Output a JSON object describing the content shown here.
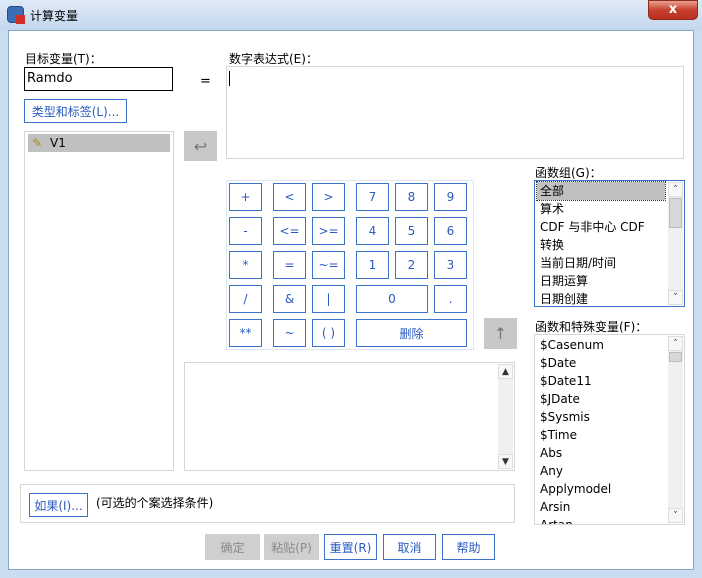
{
  "window": {
    "title": "计算变量",
    "close": "x"
  },
  "target": {
    "label": "目标变量(T)：",
    "value": "Ramdo"
  },
  "equals": "=",
  "expression": {
    "label": "数字表达式(E)：",
    "value": ""
  },
  "type_label_button": "类型和标签(L)...",
  "variables": [
    "V1"
  ],
  "keypad": [
    [
      "+",
      "<",
      ">",
      "7",
      "8",
      "9"
    ],
    [
      "-",
      "<=",
      ">=",
      "4",
      "5",
      "6"
    ],
    [
      "*",
      "=",
      "~=",
      "1",
      "2",
      "3"
    ],
    [
      "/",
      "&",
      "|",
      "0",
      "."
    ],
    [
      "**",
      "~",
      "( )",
      "删除"
    ]
  ],
  "function_group": {
    "label": "函数组(G)：",
    "items": [
      "全部",
      "算术",
      "CDF 与非中心 CDF",
      "转换",
      "当前日期/时间",
      "日期运算",
      "日期创建"
    ],
    "selected": 0
  },
  "functions": {
    "label": "函数和特殊变量(F)：",
    "items": [
      "$Casenum",
      "$Date",
      "$Date11",
      "$JDate",
      "$Sysmis",
      "$Time",
      "Abs",
      "Any",
      "Applymodel",
      "Arsin",
      "Artan"
    ]
  },
  "if_panel": {
    "button": "如果(I)...",
    "text": "(可选的个案选择条件)"
  },
  "buttons": {
    "ok": "确定",
    "paste": "粘贴(P)",
    "reset": "重置(R)",
    "cancel": "取消",
    "help": "帮助"
  }
}
